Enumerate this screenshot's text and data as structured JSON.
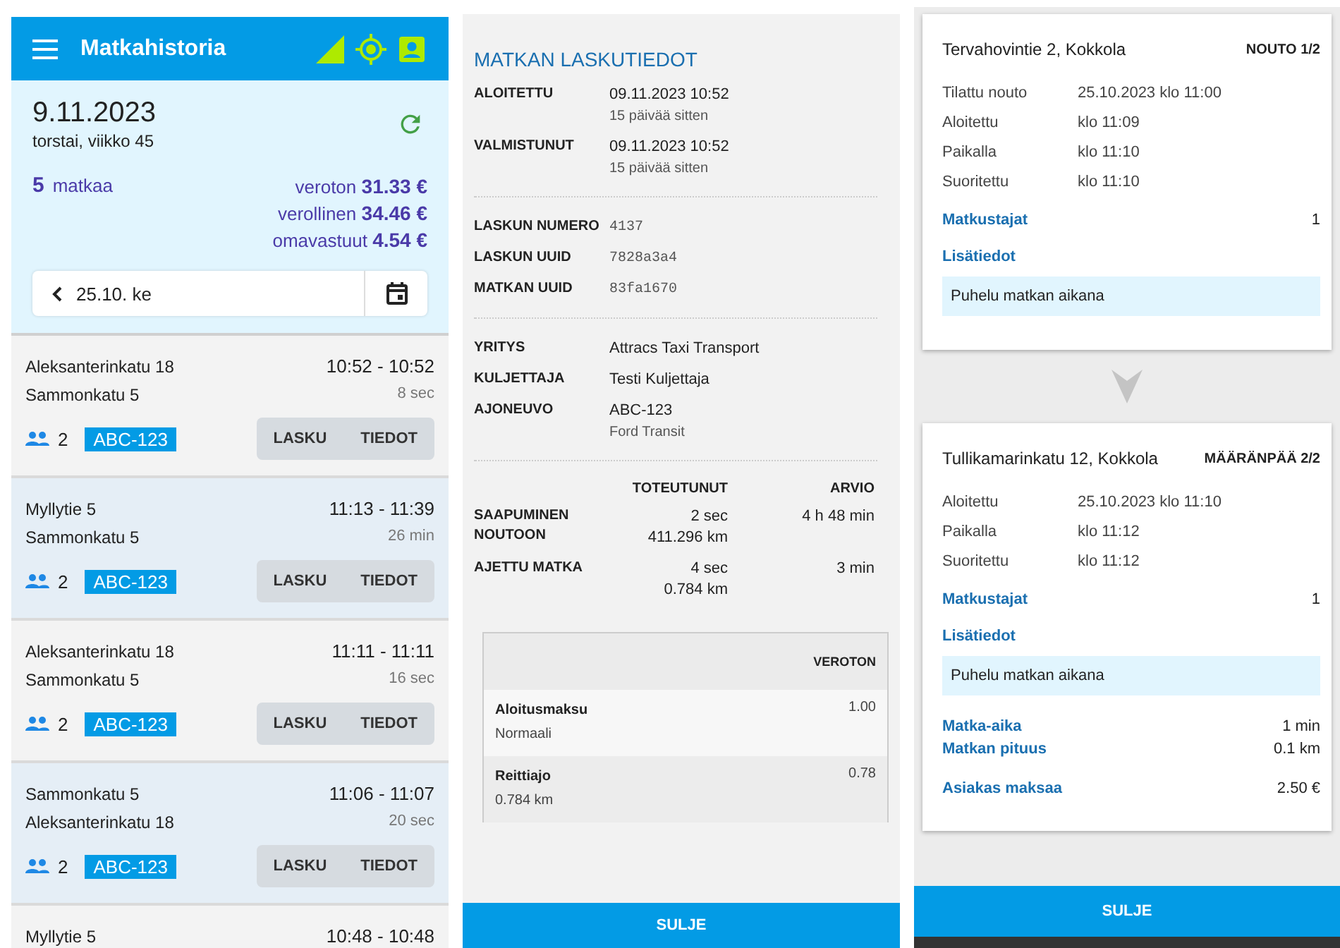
{
  "history": {
    "title": "Matkahistoria",
    "date": "9.11.2023",
    "weekday": "torstai, viikko 45",
    "trip_count": "5",
    "trip_count_label": "matkaa",
    "totals": [
      {
        "label": "veroton",
        "value": "31.33 €"
      },
      {
        "label": "verollinen",
        "value": "34.46 €"
      },
      {
        "label": "omavastuut",
        "value": "4.54 €"
      }
    ],
    "previous_day": "25.10. ke",
    "trips": [
      {
        "from": "Aleksanterinkatu 18",
        "to": "Sammonkatu 5",
        "time": "10:52 - 10:52",
        "duration": "8 sec",
        "passengers": "2",
        "plate": "ABC-123",
        "buttons": [
          "LASKU",
          "TIEDOT"
        ]
      },
      {
        "from": "Myllytie 5",
        "to": "Sammonkatu 5",
        "time": "11:13 - 11:39",
        "duration": "26 min",
        "passengers": "2",
        "plate": "ABC-123",
        "buttons": [
          "LASKU",
          "TIEDOT"
        ]
      },
      {
        "from": "Aleksanterinkatu 18",
        "to": "Sammonkatu 5",
        "time": "11:11 - 11:11",
        "duration": "16 sec",
        "passengers": "2",
        "plate": "ABC-123",
        "buttons": [
          "LASKU",
          "TIEDOT"
        ]
      },
      {
        "from": "Sammonkatu 5",
        "to": "Aleksanterinkatu 18",
        "time": "11:06 - 11:07",
        "duration": "20 sec",
        "passengers": "2",
        "plate": "ABC-123",
        "buttons": [
          "LASKU",
          "TIEDOT"
        ]
      },
      {
        "from": "Myllytie 5",
        "time": "10:48 - 10:48"
      }
    ]
  },
  "invoice": {
    "title": "MATKAN LASKUTIEDOT",
    "sections": [
      [
        {
          "label": "ALOITETTU",
          "value": "09.11.2023 10:52",
          "sub": "15 päivää sitten",
          "kind": "text"
        },
        {
          "label": "VALMISTUNUT",
          "value": "09.11.2023 10:52",
          "sub": "15 päivää sitten",
          "kind": "text"
        }
      ],
      [
        {
          "label": "LASKUN NUMERO",
          "value": "4137",
          "kind": "code"
        },
        {
          "label": "LASKUN UUID",
          "value": "7828a3a4",
          "kind": "code"
        },
        {
          "label": "MATKAN UUID",
          "value": "83fa1670",
          "kind": "code"
        }
      ],
      [
        {
          "label": "YRITYS",
          "value": "Attracs Taxi Transport",
          "kind": "text"
        },
        {
          "label": "KULJETTAJA",
          "value": "Testi Kuljettaja",
          "kind": "text"
        },
        {
          "label": "AJONEUVO",
          "value": "ABC-123",
          "sub": "Ford Transit",
          "kind": "text"
        }
      ]
    ],
    "comparison": {
      "columns": [
        "TOTEUTUNUT",
        "ARVIO"
      ],
      "rows": [
        {
          "label": "SAAPUMINEN NOUTOON",
          "actual": [
            "2 sec",
            "411.296 km"
          ],
          "estimate": "4 h 48 min"
        },
        {
          "label": "AJETTU MATKA",
          "actual": [
            "4 sec",
            "0.784 km"
          ],
          "estimate": "3 min"
        }
      ]
    },
    "prices": {
      "column": "VEROTON",
      "items": [
        {
          "name": "Aloitusmaksu",
          "detail": "Normaali",
          "amount": "1.00"
        },
        {
          "name": "Reittiajo",
          "detail": "0.784 km",
          "amount": "0.78"
        }
      ]
    },
    "close_button": "SULJE"
  },
  "details": {
    "stops": [
      {
        "address": "Tervahovintie 2, Kokkola",
        "tag": "NOUTO 1/2",
        "times": [
          {
            "label": "Tilattu nouto",
            "value": "25.10.2023 klo 11:00"
          },
          {
            "label": "Aloitettu",
            "value": "klo 11:09"
          },
          {
            "label": "Paikalla",
            "value": "klo 11:10"
          },
          {
            "label": "Suoritettu",
            "value": "klo 11:10"
          }
        ],
        "passengers_label": "Matkustajat",
        "passengers": "1",
        "info_label": "Lisätiedot",
        "info": "Puhelu matkan aikana"
      },
      {
        "address": "Tullikamarinkatu 12, Kokkola",
        "tag": "MÄÄRÄNPÄÄ 2/2",
        "times": [
          {
            "label": "Aloitettu",
            "value": "25.10.2023 klo 11:10"
          },
          {
            "label": "Paikalla",
            "value": "klo 11:12"
          },
          {
            "label": "Suoritettu",
            "value": "klo 11:12"
          }
        ],
        "passengers_label": "Matkustajat",
        "passengers": "1",
        "info_label": "Lisätiedot",
        "info": "Puhelu matkan aikana",
        "summary": [
          {
            "label": "Matka-aika",
            "value": "1 min"
          },
          {
            "label": "Matkan pituus",
            "value": "0.1 km"
          }
        ],
        "payment": {
          "label": "Asiakas maksaa",
          "value": "2.50 €"
        }
      }
    ],
    "close_button": "SULJE"
  }
}
